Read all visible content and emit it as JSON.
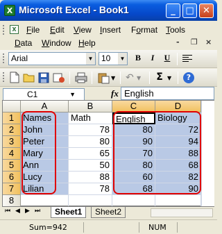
{
  "window": {
    "title": "Microsoft Excel - Book1",
    "app_icon": "X",
    "minimize_symbol": "_",
    "maximize_symbol": "□",
    "close_symbol": "✕"
  },
  "menu": {
    "items": [
      {
        "label": "File",
        "accel": "F"
      },
      {
        "label": "Edit",
        "accel": "E"
      },
      {
        "label": "View",
        "accel": "V"
      },
      {
        "label": "Insert",
        "accel": "I"
      },
      {
        "label": "Format",
        "accel": "o"
      },
      {
        "label": "Tools",
        "accel": "T"
      },
      {
        "label": "Data",
        "accel": "D"
      },
      {
        "label": "Window",
        "accel": "W"
      },
      {
        "label": "Help",
        "accel": "H"
      }
    ],
    "workbook_minimize": "-",
    "workbook_restore": "❐",
    "workbook_close": "×"
  },
  "formatting_toolbar": {
    "font_name": "Arial",
    "font_size": "10",
    "bold": "B",
    "italic": "I",
    "underline": "U"
  },
  "standard_toolbar": {
    "autosum": "Σ",
    "help": "?"
  },
  "formula_bar": {
    "name_box": "C1",
    "fx_label": "fx",
    "content": "English"
  },
  "grid": {
    "columns": [
      "A",
      "B",
      "C",
      "D"
    ],
    "selected_columns": [
      "C",
      "D"
    ],
    "rows": [
      "1",
      "2",
      "3",
      "4",
      "5",
      "6",
      "7",
      "8"
    ],
    "cells": [
      [
        "Names",
        "Math",
        "English",
        "Biology"
      ],
      [
        "John",
        "78",
        "80",
        "72"
      ],
      [
        "Peter",
        "80",
        "90",
        "94"
      ],
      [
        "Mary",
        "65",
        "70",
        "88"
      ],
      [
        "Ann",
        "50",
        "80",
        "68"
      ],
      [
        "Lucy",
        "88",
        "60",
        "82"
      ],
      [
        "Lilian",
        "78",
        "68",
        "90"
      ],
      [
        "",
        "",
        "",
        ""
      ]
    ],
    "active_cell": "C1",
    "selection": "A1:A7, C1:D7",
    "highlight_color": "#e00000",
    "selection_color": "#b9c9e5"
  },
  "sheet_tabs": {
    "tabs": [
      "Sheet1",
      "Sheet2"
    ],
    "active": "Sheet1",
    "nav": [
      "⏮",
      "◀",
      "▶",
      "⏭"
    ]
  },
  "status": {
    "sum": "Sum=942",
    "num": "NUM"
  }
}
